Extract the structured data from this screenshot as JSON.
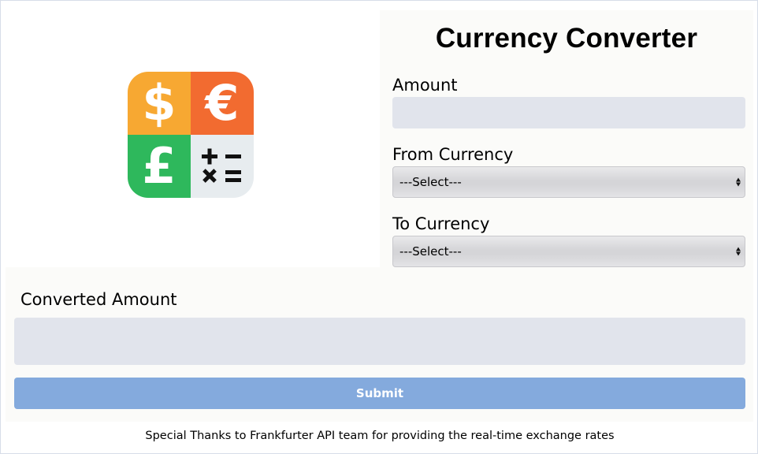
{
  "header": {
    "title": "Currency Converter"
  },
  "logo": {
    "icons": [
      "dollar-sign",
      "euro-sign",
      "pound-sign",
      "math-operators"
    ],
    "glyphs": {
      "dollar": "$",
      "euro": "€",
      "pound": "£"
    },
    "colors": {
      "dollar": "#f7a832",
      "euro": "#f26b30",
      "pound": "#2eb85c",
      "math": "#e7ecef"
    }
  },
  "form": {
    "amount_label": "Amount",
    "amount_value": "",
    "from_label": "From Currency",
    "from_selected": "---Select---",
    "to_label": "To Currency",
    "to_selected": "---Select---",
    "converted_label": "Converted Amount",
    "converted_value": "",
    "submit_label": "Submit"
  },
  "footer": {
    "text": "Special Thanks to Frankfurter API team for providing the real-time exchange rates"
  },
  "colors": {
    "input_bg": "#e1e4ec",
    "submit_bg": "#84aadd",
    "panel_bg": "#fbfbf9"
  }
}
